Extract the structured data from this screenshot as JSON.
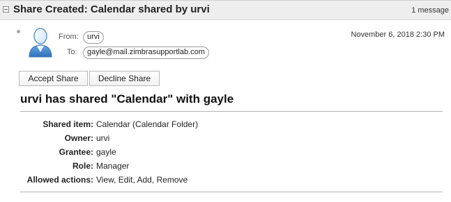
{
  "header": {
    "subject": "Share Created: Calendar shared by urvi",
    "message_count": "1 message"
  },
  "message": {
    "from_label": "From:",
    "from_value": "urvi",
    "to_label": "To:",
    "to_value": "gayle@mail.zimbrasupportlab.com",
    "date": "November 6, 2018 2:30 PM"
  },
  "actions": {
    "accept_label": "Accept Share",
    "decline_label": "Decline Share"
  },
  "share": {
    "title": "urvi has shared \"Calendar\" with gayle",
    "details": [
      {
        "label": "Shared item:",
        "value": "Calendar (Calendar Folder)"
      },
      {
        "label": "Owner:",
        "value": "urvi"
      },
      {
        "label": "Grantee:",
        "value": "gayle"
      },
      {
        "label": "Role:",
        "value": "Manager"
      },
      {
        "label": "Allowed actions:",
        "value": "View, Edit, Add, Remove"
      }
    ]
  },
  "icons": {
    "collapse": "collapse-icon",
    "avatar": "user-avatar-icon",
    "bullet": "unread-dot-icon"
  },
  "colors": {
    "header_bg": "#eeeeee",
    "avatar_blue": "#4d8fd6"
  }
}
